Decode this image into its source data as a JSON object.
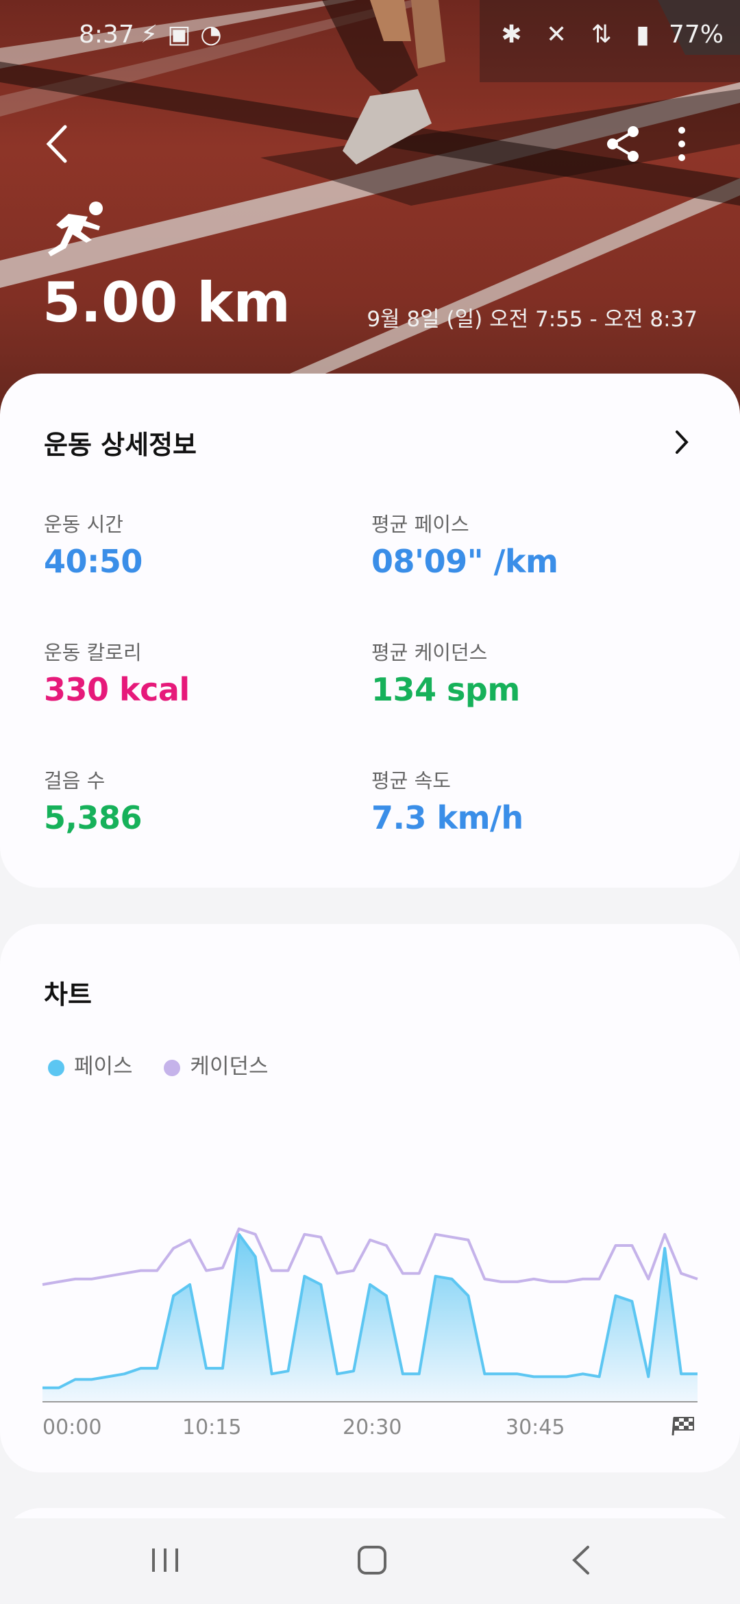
{
  "status_bar": {
    "time": "8:37",
    "battery": "77%"
  },
  "hero": {
    "distance": "5.00 km",
    "datetime": "9월 8일 (일) 오전 7:55 - 오전 8:37"
  },
  "details": {
    "title": "운동 상세정보",
    "metrics": [
      {
        "label": "운동 시간",
        "value": "40:50",
        "color": "#3a8ee8"
      },
      {
        "label": "평균 페이스",
        "value": "08'09\" /km",
        "color": "#3a8ee8"
      },
      {
        "label": "운동 칼로리",
        "value": "330 kcal",
        "color": "#e6197a"
      },
      {
        "label": "평균 케이던스",
        "value": "134 spm",
        "color": "#16b15a"
      },
      {
        "label": "걸음 수",
        "value": "5,386",
        "color": "#16b15a"
      },
      {
        "label": "평균 속도",
        "value": "7.3 km/h",
        "color": "#3a8ee8"
      }
    ]
  },
  "chart": {
    "title": "차트",
    "legend": [
      {
        "name": "페이스",
        "color": "#5cc6f2"
      },
      {
        "name": "케이던스",
        "color": "#c5b3ea"
      }
    ]
  },
  "chart_data": {
    "type": "area",
    "x_ticks": [
      "00:00",
      "10:15",
      "20:30",
      "30:45"
    ],
    "x": [
      0,
      1,
      2,
      3,
      4,
      5,
      6,
      7,
      8,
      9,
      10,
      11,
      12,
      13,
      14,
      15,
      16,
      17,
      18,
      19,
      20,
      21,
      22,
      23,
      24,
      25,
      26,
      27,
      28,
      29,
      30,
      31,
      32,
      33,
      34,
      35,
      36,
      37,
      38,
      39,
      40
    ],
    "series": [
      {
        "name": "페이스",
        "color": "#5cc6f2",
        "values": [
          5,
          5,
          8,
          8,
          9,
          10,
          12,
          12,
          38,
          42,
          12,
          12,
          60,
          52,
          10,
          11,
          45,
          42,
          10,
          11,
          42,
          38,
          10,
          10,
          45,
          44,
          38,
          10,
          10,
          10,
          9,
          9,
          9,
          10,
          9,
          38,
          36,
          9,
          55,
          10,
          10
        ]
      },
      {
        "name": "케이던스",
        "color": "#c5b3ea",
        "values": [
          42,
          43,
          44,
          44,
          45,
          46,
          47,
          47,
          55,
          58,
          47,
          48,
          62,
          60,
          47,
          47,
          60,
          59,
          46,
          47,
          58,
          56,
          46,
          46,
          60,
          59,
          58,
          44,
          43,
          43,
          44,
          43,
          43,
          44,
          44,
          56,
          56,
          44,
          60,
          46,
          44
        ]
      }
    ]
  }
}
